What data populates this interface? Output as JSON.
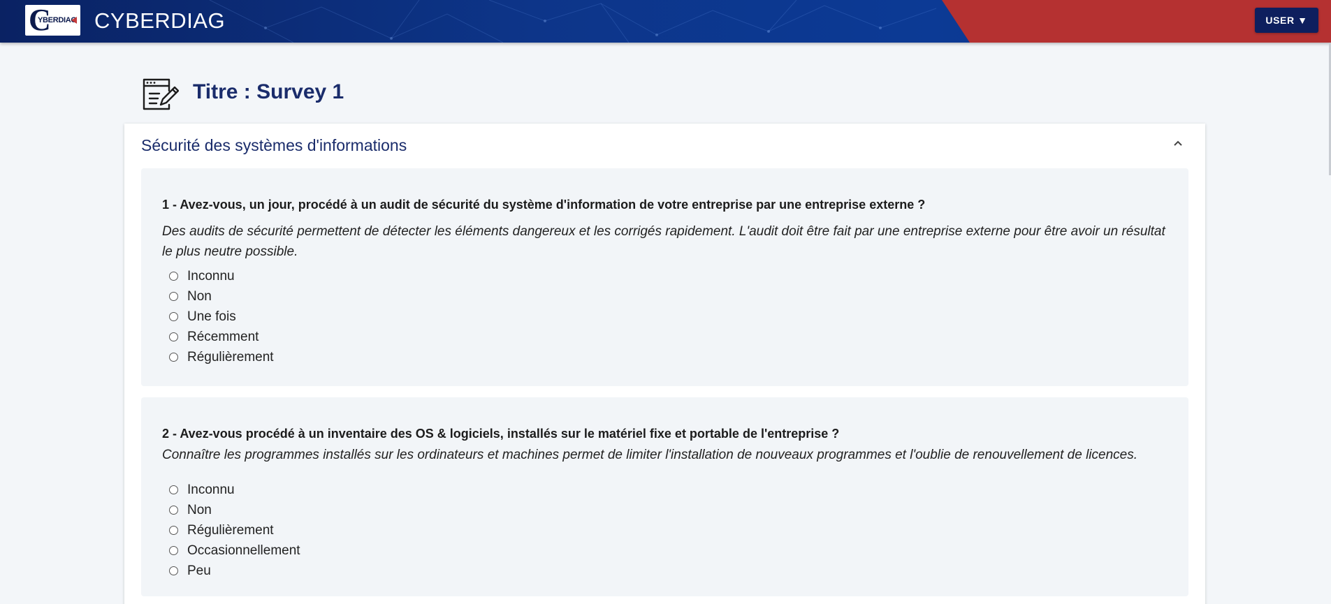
{
  "header": {
    "logo_text": "YBERDIAG",
    "logo_letter": "C",
    "app_title": "CYBERDIAG",
    "user_button": "USER ▼"
  },
  "page": {
    "title": "Titre : Survey 1",
    "title_icon": "edit-document-icon"
  },
  "section": {
    "title": "Sécurité des systèmes d'informations",
    "toggle_icon": "chevron-up-icon"
  },
  "questions": [
    {
      "text": "1 - Avez-vous, un jour, procédé à un audit de sécurité du système d'information de votre entreprise par une entreprise externe ?",
      "description": "Des audits de sécurité permettent de détecter les éléments dangereux et les corrigés rapidement. L'audit doit être fait par une entreprise externe pour être avoir un résultat le plus neutre possible.",
      "options": [
        "Inconnu",
        "Non",
        "Une fois",
        "Récemment",
        "Régulièrement"
      ]
    },
    {
      "text": "2 - Avez-vous procédé à un inventaire des OS & logiciels, installés sur le matériel fixe et portable de l'entreprise ?",
      "description": "Connaître les programmes installés sur les ordinateurs et machines permet de limiter l'installation de nouveaux programmes et l'oublie de renouvellement de licences.",
      "options": [
        "Inconnu",
        "Non",
        "Régulièrement",
        "Occasionnellement",
        "Peu"
      ]
    }
  ],
  "colors": {
    "header_blue": "#0b2a78",
    "header_red": "#b53131",
    "title_navy": "#1a2c6b",
    "user_button_bg": "#0e1f5e"
  }
}
